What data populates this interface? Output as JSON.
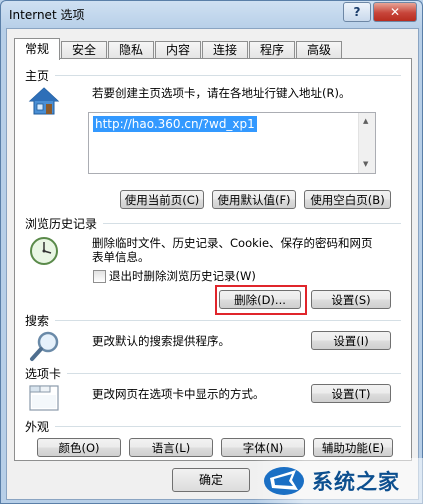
{
  "window": {
    "title": "Internet 选项",
    "help_label": "?",
    "close_label": "✕"
  },
  "tabs": [
    {
      "label": "常规",
      "active": true
    },
    {
      "label": "安全"
    },
    {
      "label": "隐私"
    },
    {
      "label": "内容"
    },
    {
      "label": "连接"
    },
    {
      "label": "程序"
    },
    {
      "label": "高级"
    }
  ],
  "homepage": {
    "label": "主页",
    "description": "若要创建主页选项卡，请在各地址行键入地址(R)。",
    "url": "http://hao.360.cn/?wd_xp1",
    "buttons": [
      "使用当前页(C)",
      "使用默认值(F)",
      "使用空白页(B)"
    ],
    "icon": "house-icon"
  },
  "history": {
    "label": "浏览历史记录",
    "description_line1": "删除临时文件、历史记录、Cookie、保存的密码和网页",
    "description_line2": "表单信息。",
    "checkbox_label": "退出时删除浏览历史记录(W)",
    "checkbox_checked": false,
    "delete_button": "删除(D)...",
    "settings_button": "设置(S)",
    "icon": "clock-icon"
  },
  "search": {
    "label": "搜索",
    "description": "更改默认的搜索提供程序。",
    "settings_button": "设置(I)",
    "icon": "magnifier-icon"
  },
  "tabs_section": {
    "label": "选项卡",
    "description": "更改网页在选项卡中显示的方式。",
    "settings_button": "设置(T)",
    "icon": "tabs-window-icon"
  },
  "appearance": {
    "label": "外观",
    "buttons": [
      "颜色(O)",
      "语言(L)",
      "字体(N)",
      "辅助功能(E)"
    ]
  },
  "footer": {
    "ok_button": "确定"
  },
  "watermark": {
    "text": "系统之家"
  },
  "colors": {
    "highlight_red": "#e0252b",
    "url_selection": "#3399ff"
  }
}
